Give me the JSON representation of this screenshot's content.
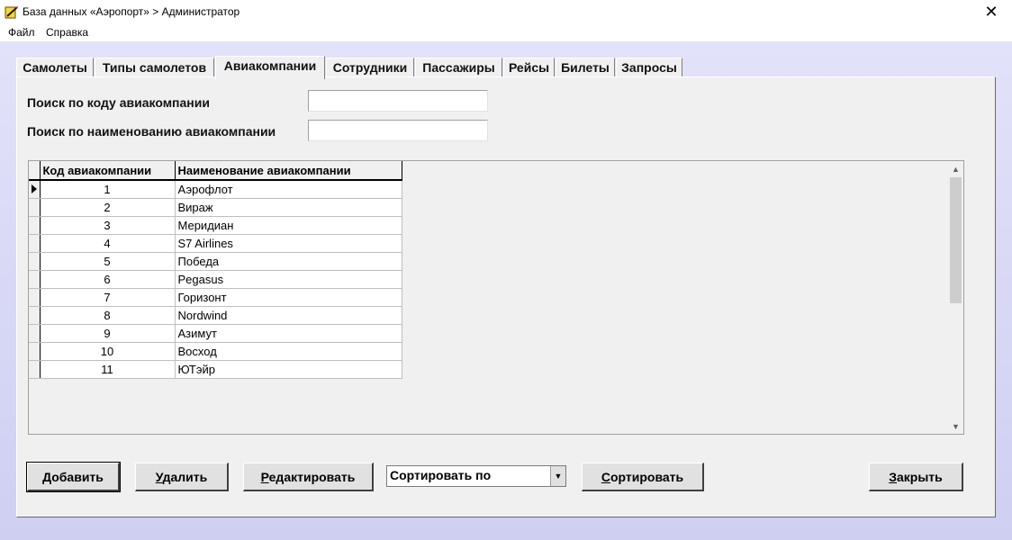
{
  "window": {
    "title": "База данных «Аэропорт» > Администратор",
    "close_glyph": "✕"
  },
  "menu": [
    "Файл",
    "Справка"
  ],
  "tabs": [
    "Самолеты",
    "Типы самолетов",
    "Авиакомпании",
    "Сотрудники",
    "Пассажиры",
    "Рейсы",
    "Билеты",
    "Запросы"
  ],
  "active_tab": "Авиакомпании",
  "search": {
    "by_code_label": "Поиск по коду авиакомпании",
    "by_code_value": "",
    "by_name_label": "Поиск по наименованию авиакомпании",
    "by_name_value": ""
  },
  "grid": {
    "columns": [
      "Код авиакомпании",
      "Наименование авиакомпании"
    ],
    "rows": [
      [
        "1",
        "Аэрофлот"
      ],
      [
        "2",
        "Вираж"
      ],
      [
        "3",
        "Меридиан"
      ],
      [
        "4",
        "S7 Airlines"
      ],
      [
        "5",
        "Победа"
      ],
      [
        "6",
        "Pegasus"
      ],
      [
        "7",
        "Горизонт"
      ],
      [
        "8",
        "Nordwind"
      ],
      [
        "9",
        "Азимут"
      ],
      [
        "10",
        "Восход"
      ],
      [
        "11",
        "ЮТэйр"
      ]
    ],
    "current_row": 0
  },
  "buttons": {
    "add": {
      "hot": "Д",
      "rest": "обавить"
    },
    "delete": {
      "hot": "У",
      "rest": "далить"
    },
    "edit": {
      "hot": "Р",
      "rest": "едактировать"
    },
    "sort": {
      "hot": "С",
      "rest": "ортировать"
    },
    "close": {
      "hot": "З",
      "rest": "акрыть"
    }
  },
  "sort_select": {
    "value": "Сортировать по"
  },
  "colors": {
    "desktop": "#d8d8f6",
    "panel": "#f0f0f0",
    "button": "#e1e1e1"
  }
}
